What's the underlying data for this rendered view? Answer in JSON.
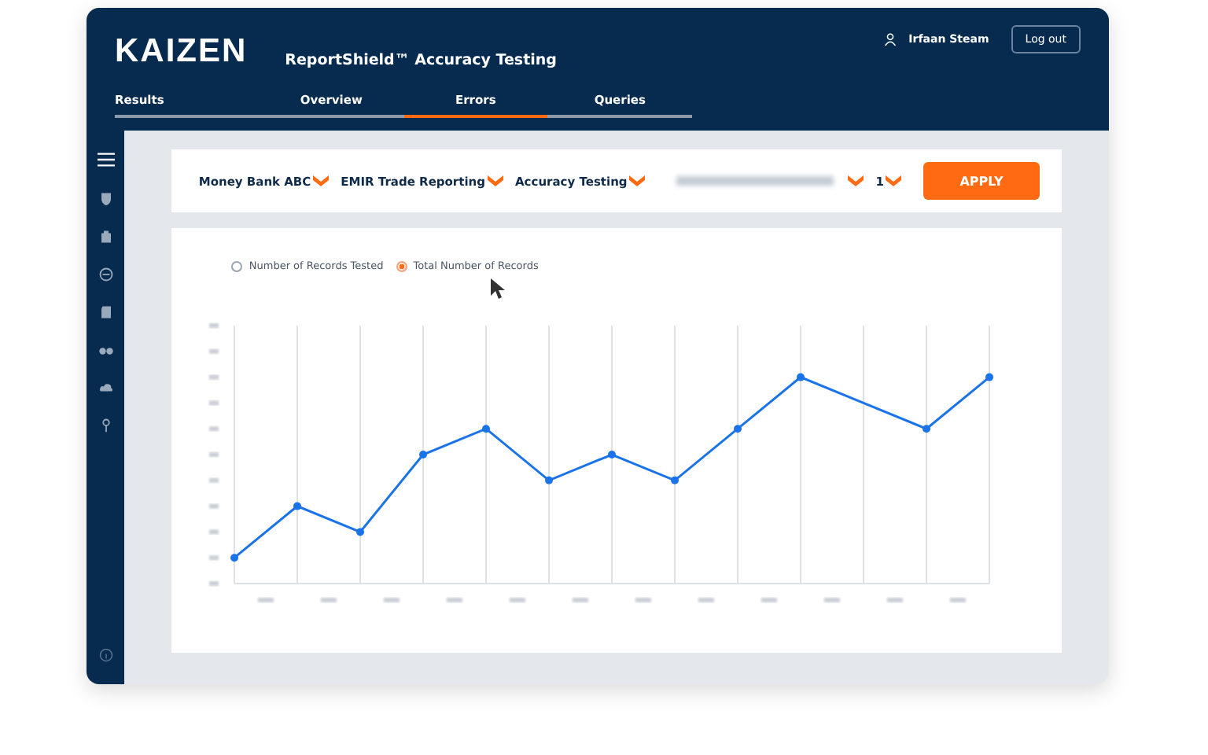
{
  "header": {
    "logo": "KAIZEN",
    "app_title": "ReportShield™ Accuracy Testing",
    "user": "Irfaan Steam",
    "logout": "Log out"
  },
  "tabs": [
    {
      "label": "Results",
      "selected": false
    },
    {
      "label": "Overview",
      "selected": false
    },
    {
      "label": "Errors",
      "selected": true
    },
    {
      "label": "Queries",
      "selected": false
    }
  ],
  "sidebar": {
    "items": [
      {
        "kind": "menu"
      },
      {
        "kind": "shield"
      },
      {
        "kind": "bag"
      },
      {
        "kind": "gauge"
      },
      {
        "kind": "doc"
      },
      {
        "kind": "binoculars"
      },
      {
        "kind": "cloud"
      },
      {
        "kind": "key"
      },
      {
        "kind": "info"
      }
    ]
  },
  "filters": [
    {
      "kind": "text",
      "label": "Money Bank ABC"
    },
    {
      "kind": "text",
      "label": "EMIR Trade Reporting"
    },
    {
      "kind": "text",
      "label": "Accuracy Testing"
    },
    {
      "kind": "redacted"
    },
    {
      "kind": "text",
      "label": "1"
    }
  ],
  "apply_button": "APPLY",
  "radios": [
    {
      "label": "Number of Records Tested",
      "selected": false
    },
    {
      "label": "Total Number of Records",
      "selected": true
    }
  ]
}
